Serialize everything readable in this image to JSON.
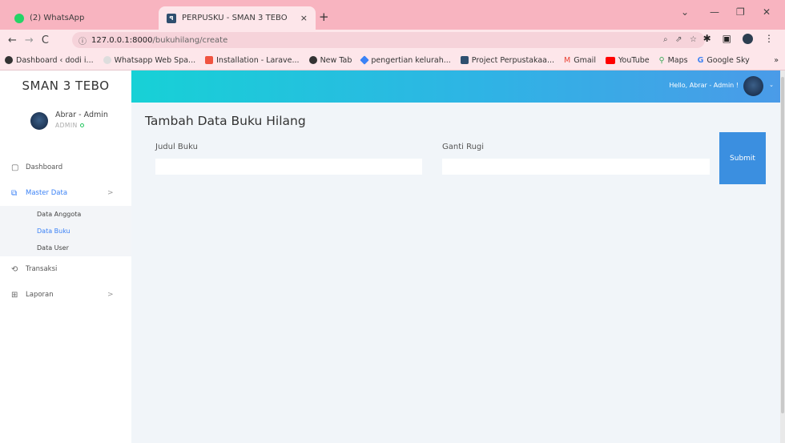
{
  "browser": {
    "tabs": [
      {
        "title": "(2) WhatsApp",
        "close": "×"
      },
      {
        "title": "PERPUSKU - SMAN 3 TEBO",
        "close": "×"
      }
    ],
    "new_tab": "+",
    "window_controls": {
      "collapse": "⌄",
      "minimize": "—",
      "restore": "❐",
      "close": "✕"
    },
    "nav": {
      "back": "←",
      "forward": "→",
      "reload": "C"
    },
    "address": {
      "domain": "127.0.0.1:8000",
      "path": "/bukuhilang/create"
    },
    "bookmarks": [
      {
        "label": "Dashboard ‹ dodi i...",
        "color": "#333333"
      },
      {
        "label": "Whatsapp Web Spa...",
        "color": "#dddddd"
      },
      {
        "label": "Installation - Larave...",
        "color": "#f05340"
      },
      {
        "label": "New Tab",
        "color": "#333333"
      },
      {
        "label": "pengertian kelurah...",
        "color": "#3b82f6"
      },
      {
        "label": "Project Perpustakaa...",
        "color": "#2f4f6f"
      },
      {
        "label": "Gmail",
        "color": "#ea4335"
      },
      {
        "label": "YouTube",
        "color": "#ff0000"
      },
      {
        "label": "Maps",
        "color": "#34a853"
      },
      {
        "label": "Google Sky",
        "color": "#4285f4"
      }
    ],
    "bookmarks_more": "»"
  },
  "sidebar": {
    "brand": "SMAN 3 TEBO",
    "profile": {
      "name": "Abrar - Admin",
      "role": "ADMIN"
    },
    "menu": [
      {
        "label": "Dashboard",
        "icon": "▢"
      },
      {
        "label": "Master Data",
        "icon": "⧉",
        "chevron": ">"
      },
      {
        "label": "Transaksi",
        "icon": "⟲"
      },
      {
        "label": "Laporan",
        "icon": "⊞",
        "chevron": ">"
      }
    ],
    "submenu": [
      {
        "label": "Data Anggota"
      },
      {
        "label": "Data Buku"
      },
      {
        "label": "Data User"
      }
    ]
  },
  "topbar": {
    "greeting": "Hello, Abrar - Admin !",
    "caret": "⌄"
  },
  "main": {
    "title": "Tambah Data Buku Hilang",
    "fields": [
      {
        "label": "Judul Buku",
        "value": ""
      },
      {
        "label": "Ganti Rugi",
        "value": ""
      }
    ],
    "submit_label": "Submit"
  },
  "colors": {
    "accent": "#3b8fe0",
    "header_start": "#17d1d6",
    "header_end": "#4a9be8",
    "browser_frame": "#f8b4c0"
  }
}
